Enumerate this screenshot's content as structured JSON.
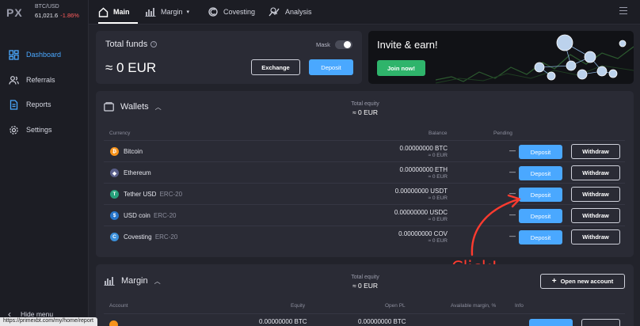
{
  "ticker": {
    "logo": "PX",
    "pair": "BTC/USD",
    "price": "61,021.6",
    "change": "-1.86%"
  },
  "sidebar": {
    "items": [
      {
        "label": "Dashboard",
        "icon": "dashboard-icon",
        "active": true
      },
      {
        "label": "Referrals",
        "icon": "users-icon",
        "active": false
      },
      {
        "label": "Reports",
        "icon": "document-icon",
        "active": false
      },
      {
        "label": "Settings",
        "icon": "gear-icon",
        "active": false
      }
    ],
    "hide_menu": "Hide menu"
  },
  "status_url": "https://primexbt.com/my/home/report",
  "topnav": {
    "tabs": [
      {
        "label": "Main",
        "icon": "home-icon",
        "active": true
      },
      {
        "label": "Margin",
        "icon": "bar-chart-icon",
        "active": false
      },
      {
        "label": "Covesting",
        "icon": "covesting-icon",
        "active": false
      },
      {
        "label": "Analysis",
        "icon": "analysis-icon",
        "active": false
      }
    ]
  },
  "total_funds": {
    "title": "Total funds",
    "value": "≈ 0 EUR",
    "mask_label": "Mask",
    "exchange_label": "Exchange",
    "deposit_label": "Deposit"
  },
  "invite": {
    "title": "Invite & earn!",
    "join_label": "Join now!"
  },
  "wallets": {
    "title": "Wallets",
    "equity_label": "Total equity",
    "equity_value": "≈ 0 EUR",
    "columns": {
      "currency": "Currency",
      "balance": "Balance",
      "pending": "Pending"
    },
    "rows": [
      {
        "name": "Bitcoin",
        "sub": "",
        "balance": "0.00000000 BTC",
        "balance_eur": "≈ 0 EUR",
        "pending": "—",
        "deposit": "Deposit",
        "withdraw": "Withdraw",
        "coin_color": "#f7931a",
        "coin_glyph": "₿"
      },
      {
        "name": "Ethereum",
        "sub": "",
        "balance": "0.00000000 ETH",
        "balance_eur": "≈ 0 EUR",
        "pending": "—",
        "deposit": "Deposit",
        "withdraw": "Withdraw",
        "coin_color": "#5a5f8a",
        "coin_glyph": "◆"
      },
      {
        "name": "Tether USD",
        "sub": "ERC-20",
        "balance": "0.00000000 USDT",
        "balance_eur": "≈ 0 EUR",
        "pending": "—",
        "deposit": "Deposit",
        "withdraw": "Withdraw",
        "coin_color": "#26a17b",
        "coin_glyph": "T"
      },
      {
        "name": "USD coin",
        "sub": "ERC-20",
        "balance": "0.00000000 USDC",
        "balance_eur": "≈ 0 EUR",
        "pending": "—",
        "deposit": "Deposit",
        "withdraw": "Withdraw",
        "coin_color": "#2775ca",
        "coin_glyph": "$"
      },
      {
        "name": "Covesting",
        "sub": "ERC-20",
        "balance": "0.00000000 COV",
        "balance_eur": "≈ 0 EUR",
        "pending": "—",
        "deposit": "Deposit",
        "withdraw": "Withdraw",
        "coin_color": "#3b8fd9",
        "coin_glyph": "C"
      }
    ]
  },
  "annotation": {
    "text": "Click!",
    "color": "#ff3b2f"
  },
  "margin": {
    "title": "Margin",
    "equity_label": "Total equity",
    "equity_value": "≈ 0 EUR",
    "open_account_label": "Open new account",
    "columns": {
      "account": "Account",
      "equity": "Equity",
      "open_pl": "Open PL",
      "available_margin": "Available margin, %",
      "info": "Info"
    },
    "first_row": {
      "equity": "0.00000000 BTC",
      "open_pl": "0.00000000 BTC"
    }
  },
  "colors": {
    "accent": "#4aa8ff",
    "green": "#2fb46b",
    "negative": "#ff5c5c",
    "panel": "#2a2b35",
    "background": "#22232b"
  }
}
